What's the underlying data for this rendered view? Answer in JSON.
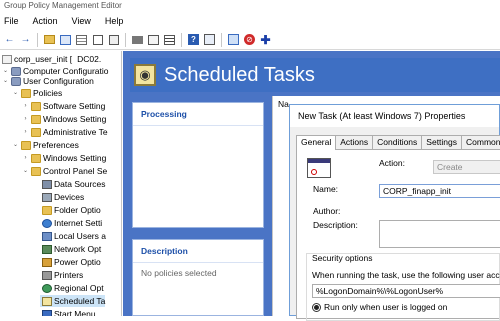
{
  "window": {
    "title": "Group Policy Management Editor"
  },
  "menu": [
    "File",
    "Action",
    "View",
    "Help"
  ],
  "toolbar": {
    "arrows": [
      "←",
      "→"
    ]
  },
  "tree": {
    "root_label": "corp_user_init [",
    "root_suffix": "DC02.",
    "items": [
      {
        "label": "Computer Configuratio",
        "toggle": "⌄"
      },
      {
        "label": "User Configuration",
        "toggle": "⌄"
      },
      {
        "label": "Policies",
        "toggle": "⌄"
      },
      {
        "label": "Software Setting",
        "toggle": "›"
      },
      {
        "label": "Windows Setting",
        "toggle": "›"
      },
      {
        "label": "Administrative Te",
        "toggle": "›"
      },
      {
        "label": "Preferences",
        "toggle": "⌄"
      },
      {
        "label": "Windows Setting",
        "toggle": "›"
      },
      {
        "label": "Control Panel Se",
        "toggle": "⌄"
      },
      {
        "label": "Data Sources",
        "toggle": ""
      },
      {
        "label": "Devices",
        "toggle": ""
      },
      {
        "label": "Folder Optio",
        "toggle": ""
      },
      {
        "label": "Internet Setti",
        "toggle": ""
      },
      {
        "label": "Local Users a",
        "toggle": ""
      },
      {
        "label": "Network Opt",
        "toggle": ""
      },
      {
        "label": "Power Optio",
        "toggle": ""
      },
      {
        "label": "Printers",
        "toggle": ""
      },
      {
        "label": "Regional Opt",
        "toggle": ""
      },
      {
        "label": "Scheduled Ta",
        "toggle": ""
      },
      {
        "label": "Start Menu",
        "toggle": ""
      }
    ]
  },
  "header": {
    "title": "Scheduled Tasks"
  },
  "processing": {
    "title": "Processing"
  },
  "description": {
    "title": "Description",
    "text": "No policies selected"
  },
  "center": {
    "column_label": "Na"
  },
  "dialog": {
    "title": "New Task (At least Windows 7) Properties",
    "tabs": [
      "General",
      "Actions",
      "Conditions",
      "Settings",
      "Common"
    ],
    "action_label": "Action:",
    "action_value": "Create",
    "name_label": "Name:",
    "name_value": "CORP_finapp_init",
    "author_label": "Author:",
    "description_label": "Description:",
    "security_label": "Security options",
    "security_text": "When running the task, use the following user account",
    "account_value": "%LogonDomain%\\%LogonUser%",
    "radio_label": "Run only when user is logged on"
  }
}
